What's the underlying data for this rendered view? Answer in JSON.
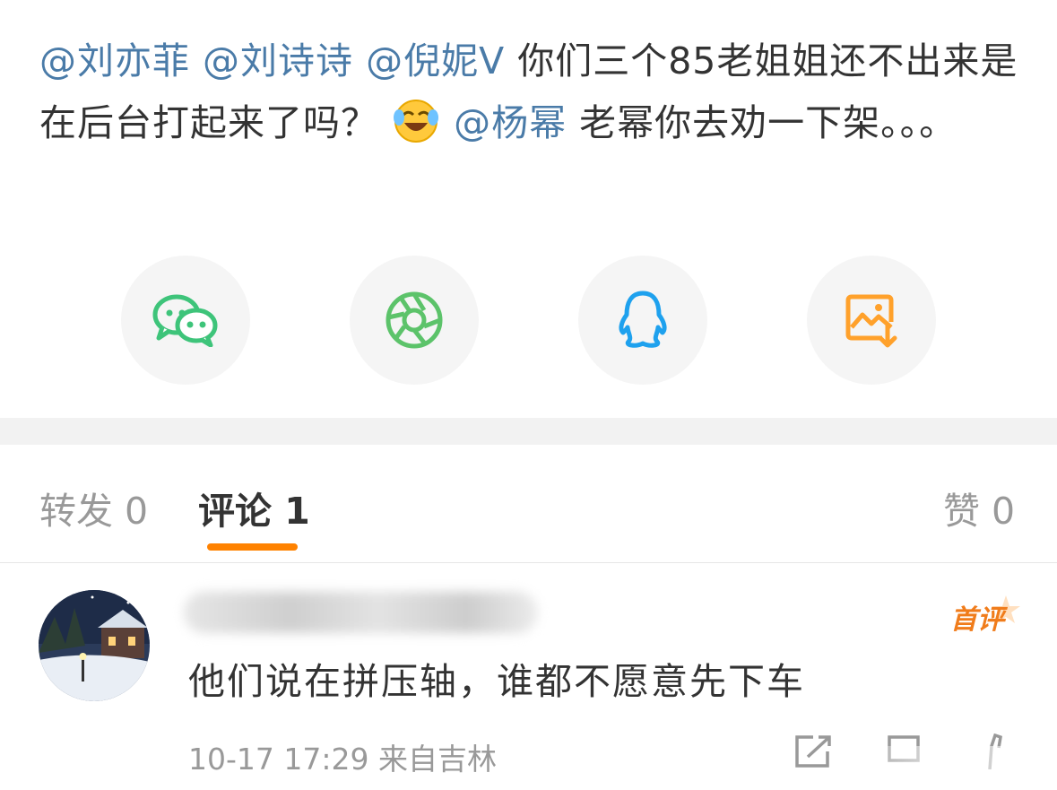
{
  "post": {
    "mentions": [
      "@刘亦菲",
      "@刘诗诗",
      "@倪妮Ⅴ",
      "@杨幂"
    ],
    "text_a": "你们三个85老姐姐还不出来是在后台打起来了吗？",
    "text_b": "老幂你去劝一下架。。。",
    "emoji": "laughing-crying-emoji"
  },
  "share": {
    "items": [
      {
        "name": "wechat-icon",
        "color": "#3ec47a"
      },
      {
        "name": "moments-icon",
        "color": "#5cc36a"
      },
      {
        "name": "qq-icon",
        "color": "#1ea1ee"
      },
      {
        "name": "save-image-icon",
        "color": "#ffa12b"
      }
    ]
  },
  "tabs": {
    "repost": "转发 0",
    "comment": "评论 1",
    "like": "赞 0",
    "accent": "#ff8200"
  },
  "comment": {
    "badge": "首评",
    "text": "他们说在拼压轴，谁都不愿意先下车",
    "meta": "10-17 17:29 来自吉林",
    "actions": [
      "share-icon",
      "comment-icon",
      "like-icon"
    ]
  }
}
